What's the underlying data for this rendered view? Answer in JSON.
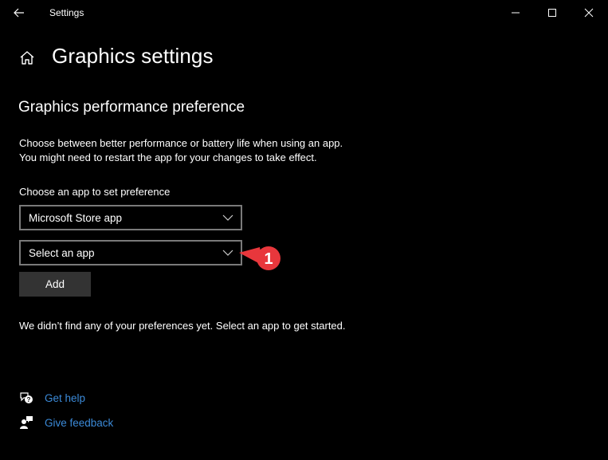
{
  "window": {
    "title": "Settings",
    "controls": {
      "minimize": "minimize",
      "maximize": "maximize",
      "close": "close"
    }
  },
  "header": {
    "page_title": "Graphics settings"
  },
  "section": {
    "title": "Graphics performance preference",
    "description_line1": "Choose between better performance or battery life when using an app.",
    "description_line2": "You might need to restart the app for your changes to take effect.",
    "choose_label": "Choose an app to set preference",
    "app_type_select": {
      "value": "Microsoft Store app"
    },
    "app_select": {
      "value": "Select an app"
    },
    "add_label": "Add",
    "empty_message": "We didn’t find any of your preferences yet. Select an app to get started."
  },
  "links": {
    "get_help": "Get help",
    "give_feedback": "Give feedback"
  },
  "annotation": {
    "number": "1",
    "color": "#e8373c"
  },
  "colors": {
    "link": "#3b8ad8",
    "button_bg": "#333333",
    "border": "#7a7a7a"
  }
}
